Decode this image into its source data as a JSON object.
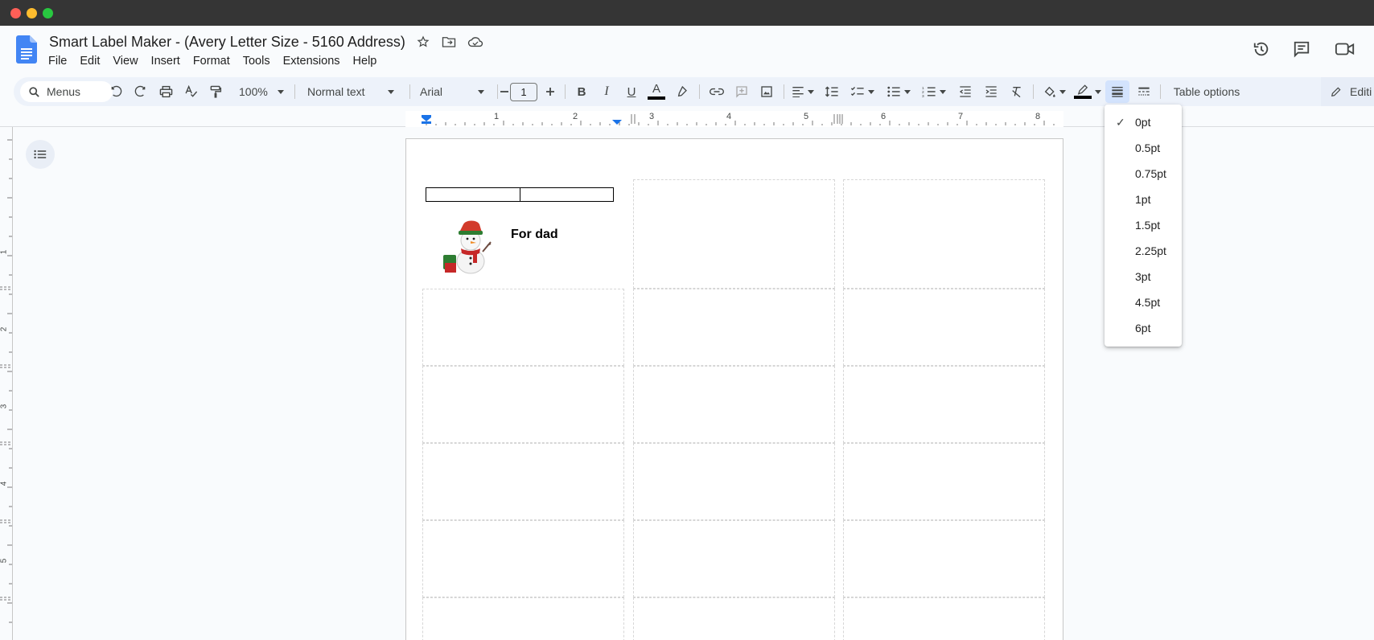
{
  "window": {
    "controls": [
      "close",
      "minimize",
      "zoom"
    ]
  },
  "doc": {
    "title": "Smart Label Maker - (Avery Letter Size - 5160 Address)"
  },
  "menubar": {
    "items": [
      "File",
      "Edit",
      "View",
      "Insert",
      "Format",
      "Tools",
      "Extensions",
      "Help"
    ]
  },
  "toolbar": {
    "search_label": "Menus",
    "zoom": "100%",
    "style": "Normal text",
    "font": "Arial",
    "font_size": "1",
    "table_options": "Table options",
    "edit_label": "Editi"
  },
  "ruler": {
    "labels": [
      "1",
      "2",
      "3",
      "4",
      "5",
      "6",
      "7",
      "8"
    ],
    "vlabels": [
      "1",
      "2",
      "3",
      "4",
      "5"
    ]
  },
  "document": {
    "label_text": "For dad"
  },
  "border_width_menu": {
    "selected": "0pt",
    "options": [
      "0pt",
      "0.5pt",
      "0.75pt",
      "1pt",
      "1.5pt",
      "2.25pt",
      "3pt",
      "4.5pt",
      "6pt"
    ]
  },
  "colors": {
    "accent": "#1a73e8",
    "toolbar_bg": "#edf2fa",
    "active_bg": "#d3e3fd"
  }
}
